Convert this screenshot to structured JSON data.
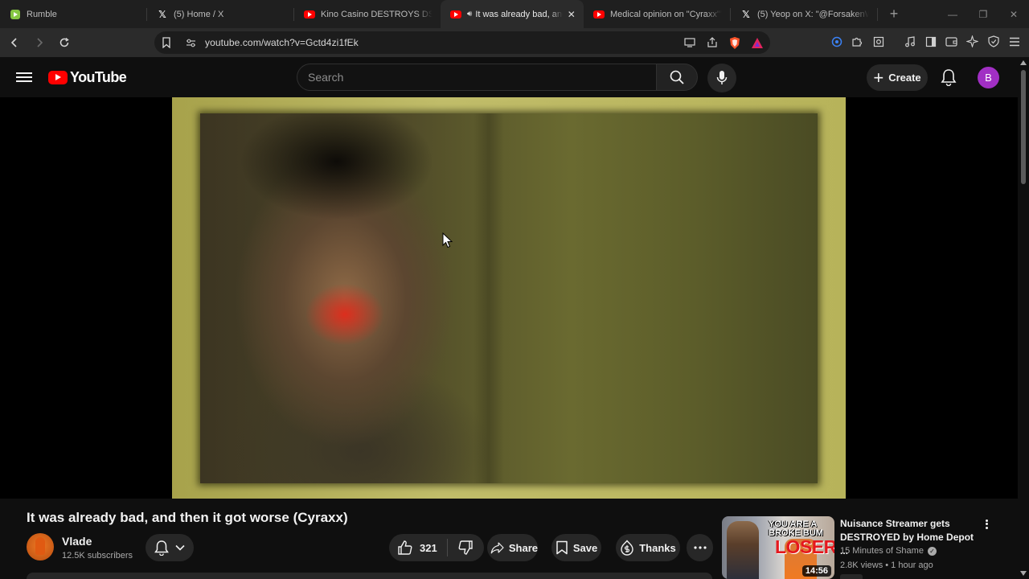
{
  "browser": {
    "tabs": [
      {
        "title": "Rumble",
        "favicon": "rumble-icon",
        "active": false
      },
      {
        "title": "(5) Home / X",
        "favicon": "x-icon",
        "active": false
      },
      {
        "title": "Kino Casino DESTROYS DSP aga",
        "favicon": "youtube-icon",
        "active": false
      },
      {
        "title": "It was already bad, and then it",
        "favicon": "youtube-icon",
        "active": true
      },
      {
        "title": "Medical opinion on \"Cyraxx\"'s m",
        "favicon": "youtube-icon",
        "active": false
      },
      {
        "title": "(5) Yeop on X: \"@ForsakenWan",
        "favicon": "x-icon",
        "active": false
      }
    ],
    "url": "youtube.com/watch?v=Gctd4zi1fEk"
  },
  "youtube": {
    "logo_text": "YouTube",
    "search_placeholder": "Search",
    "create_label": "Create",
    "avatar_letter": "B",
    "avatar_color": "#a12fc4",
    "accent_color": "#ff0000"
  },
  "video": {
    "title": "It was already bad, and then it got worse (Cyraxx)",
    "channel": "Vlade",
    "subscribers": "12.5K subscribers",
    "likes": "321",
    "share_label": "Share",
    "save_label": "Save",
    "thanks_label": "Thanks"
  },
  "recommendation": {
    "title": "Nuisance Streamer gets DESTROYED by Home Depot ...",
    "channel": "15 Minutes of Shame",
    "meta": "2.8K views • 1 hour ago",
    "duration": "14:56",
    "thumb_text_1": "YOU ARE A",
    "thumb_text_2": "BROKE BUM",
    "thumb_text_3": "LOSER"
  }
}
